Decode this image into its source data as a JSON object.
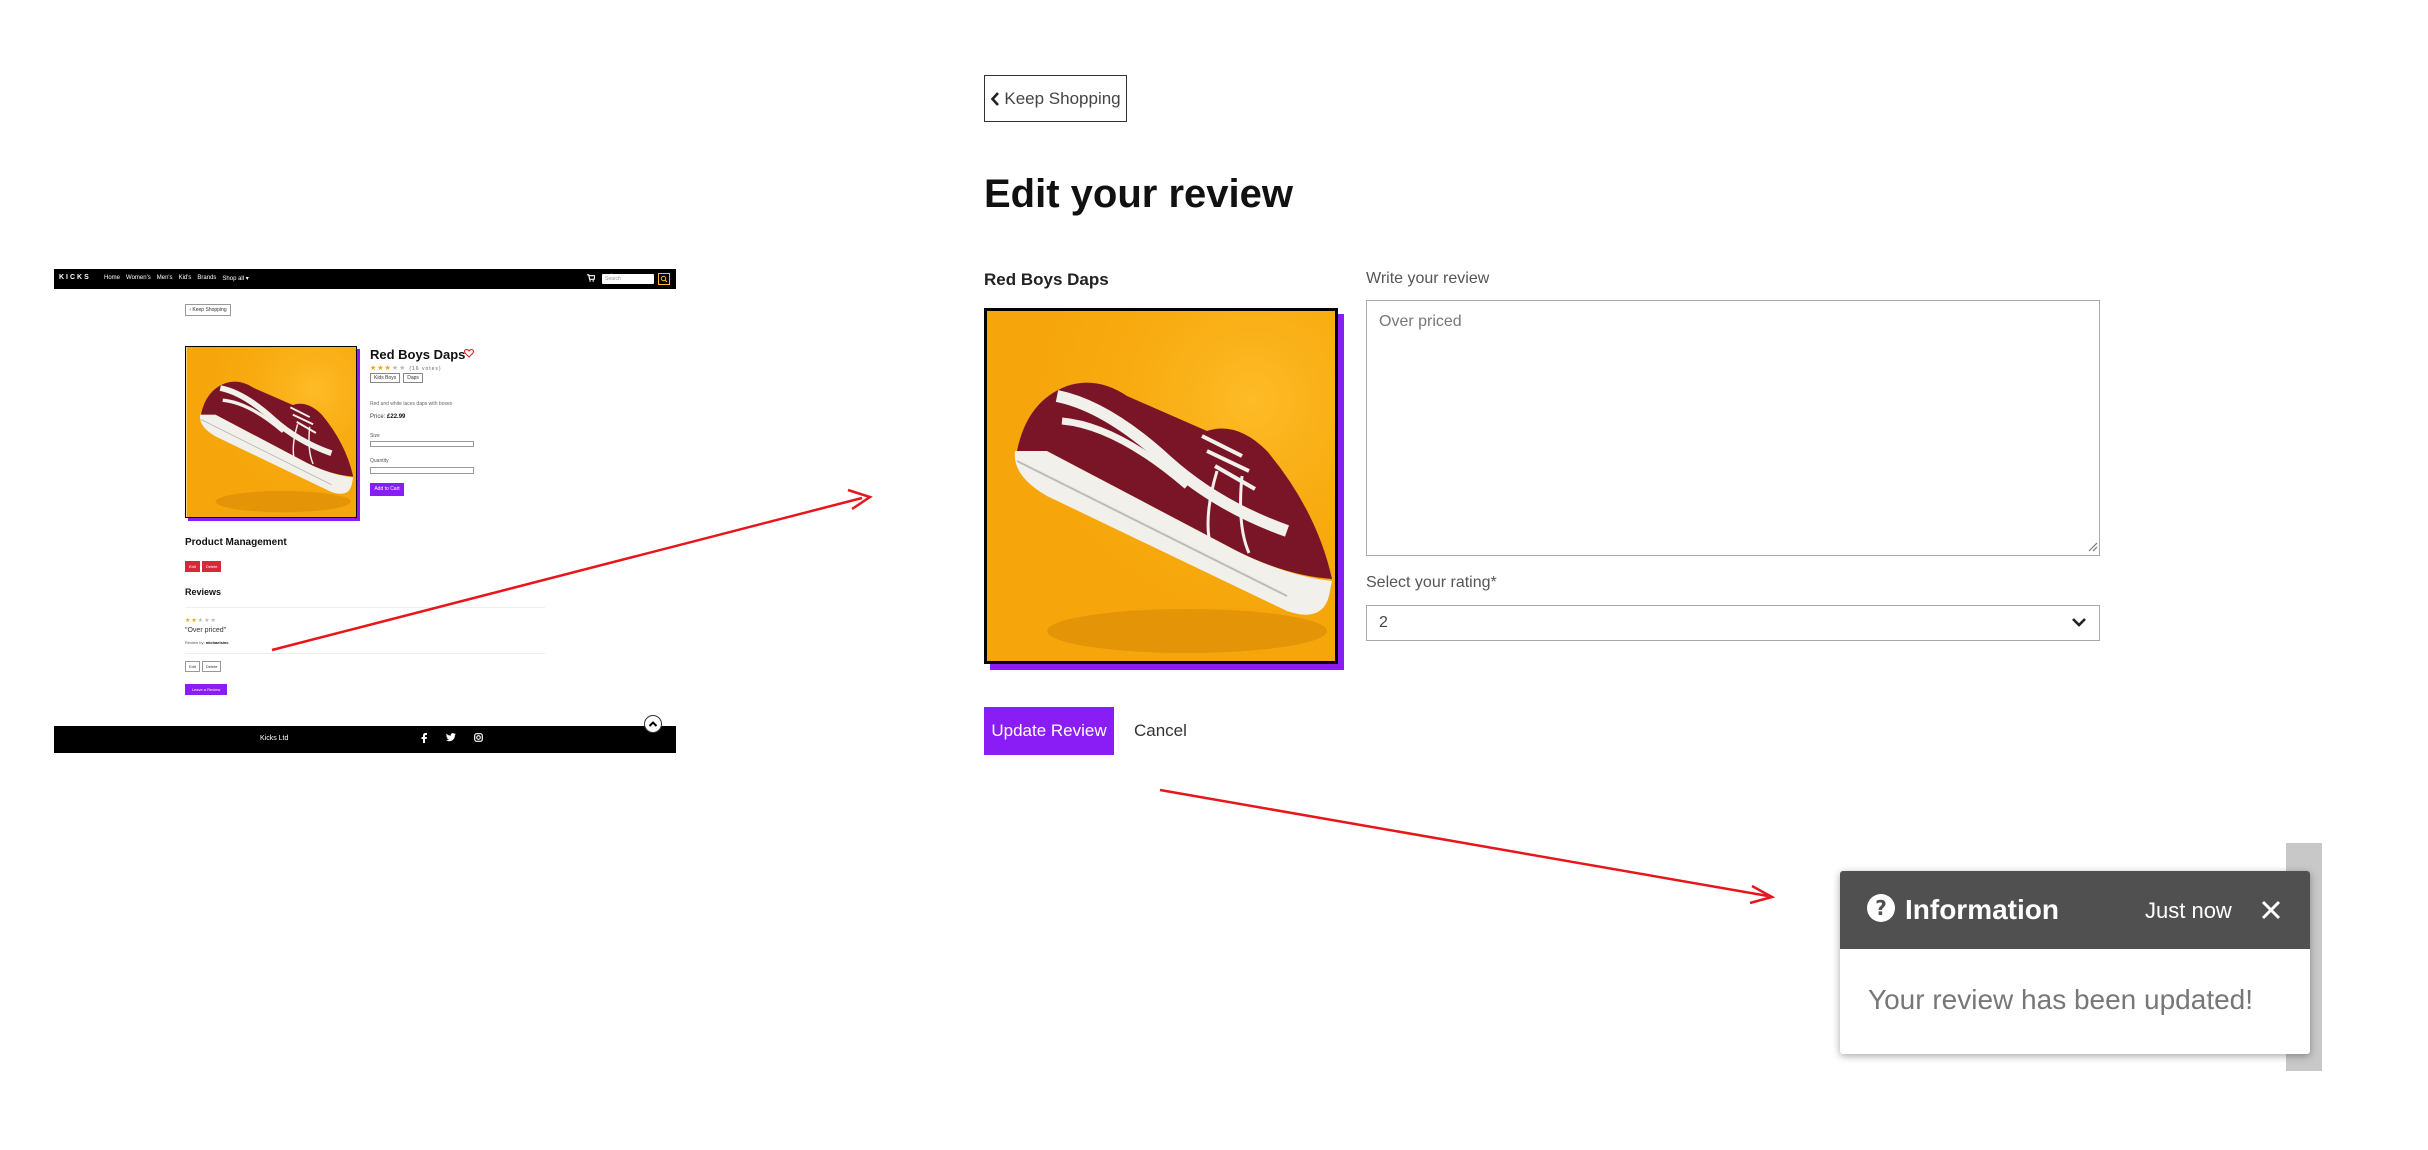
{
  "mini_page": {
    "nav": {
      "logo": "KICKS",
      "links": [
        "Home",
        "Women's",
        "Men's",
        "Kid's",
        "Brands",
        "Shop all ▾"
      ],
      "search_placeholder": "Search"
    },
    "keep_shopping": "‹ Keep Shopping",
    "product_title": "Red Boys Daps",
    "rating_count": "(16 votes)",
    "tags": [
      "Kids Boys",
      "Daps"
    ],
    "description": "Red and white laces daps with boxes",
    "price_label": "Price:",
    "price_value": "£22.99",
    "size_label": "Size",
    "quantity_label": "Quantity",
    "add_to_cart": "Add to Cart",
    "product_management": "Product Management",
    "edit_label": "Edit",
    "delete_label": "Delete",
    "reviews_heading": "Reviews",
    "review_quote": "\"Over priced\"",
    "review_by_label": "Review by:",
    "review_by_user": "michaelsinc",
    "review_edit": "Edit",
    "review_delete": "Delete",
    "leave_review": "Leave a Review",
    "footer_brand": "Kicks Ltd"
  },
  "form": {
    "keep_shopping": "Keep Shopping",
    "page_title": "Edit your review",
    "product_name": "Red Boys Daps",
    "review_label": "Write your review",
    "review_value": "Over priced",
    "rating_label": "Select your rating*",
    "rating_value": "2",
    "update_button": "Update Review",
    "cancel": "Cancel"
  },
  "toast": {
    "title": "Information",
    "time": "Just now",
    "message": "Your review has been updated!"
  },
  "colors": {
    "accent_purple": "#8a1cf5",
    "delete_red": "#d62839",
    "toast_header": "#505050",
    "arrow_red": "#e8161b",
    "product_bg": "#f6a60a"
  },
  "icons": [
    "chevron-left-icon",
    "heart-icon",
    "cart-icon",
    "user-icon",
    "search-icon",
    "facebook-icon",
    "twitter-icon",
    "instagram-icon",
    "chevron-up-icon",
    "chevron-down-icon",
    "question-circle-icon",
    "close-icon"
  ]
}
